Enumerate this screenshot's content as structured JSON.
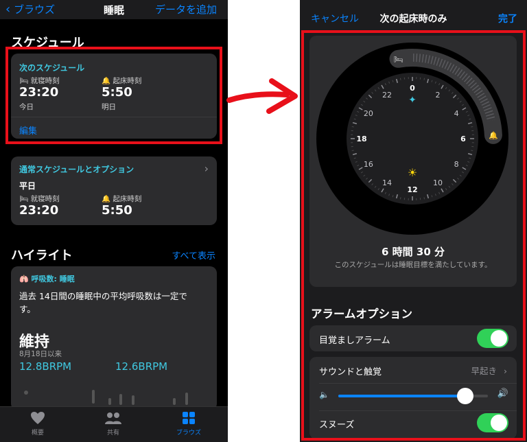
{
  "left": {
    "nav": {
      "back": "ブラウズ",
      "title": "睡眠",
      "right": "データを追加"
    },
    "schedule_heading": "スケジュール",
    "next_schedule": {
      "title": "次のスケジュール",
      "bed_label": "就寝時刻",
      "bed_time": "23:20",
      "bed_day": "今日",
      "wake_label": "起床時刻",
      "wake_time": "5:50",
      "wake_day": "明日",
      "edit": "編集"
    },
    "regular": {
      "title": "通常スケジュールとオプション",
      "day": "平日",
      "bed_label": "就寝時刻",
      "bed_time": "23:20",
      "wake_label": "起床時刻",
      "wake_time": "5:50"
    },
    "highlights": {
      "heading": "ハイライト",
      "show_all": "すべて表示",
      "tag": "呼吸数: 睡眠",
      "text": "過去 14日間の睡眠中の平均呼吸数は一定です。",
      "status": "維持",
      "since": "8月18日以来",
      "value1": "12.8BRPM",
      "value2": "12.6BRPM"
    },
    "tabs": [
      "概要",
      "共有",
      "ブラウズ"
    ]
  },
  "right": {
    "nav": {
      "cancel": "キャンセル",
      "title": "次の起床時のみ",
      "done": "完了"
    },
    "clock": {
      "hours": [
        "0",
        "2",
        "4",
        "6",
        "8",
        "10",
        "12",
        "14",
        "16",
        "18",
        "20",
        "22"
      ]
    },
    "duration": "6 時間 30 分",
    "duration_note": "このスケジュールは睡眠目標を満たしています。",
    "alarm_heading": "アラームオプション",
    "wake_alarm": "目覚ましアラーム",
    "wake_alarm_on": true,
    "sound_label": "サウンドと触覚",
    "sound_value": "早起き",
    "volume": 0.85,
    "snooze": "スヌーズ",
    "snooze_on": true
  },
  "colors": {
    "accent_blue": "#0a84ff",
    "teal": "#40c8e0",
    "green": "#30d158",
    "highlight_red": "#e8101a"
  }
}
